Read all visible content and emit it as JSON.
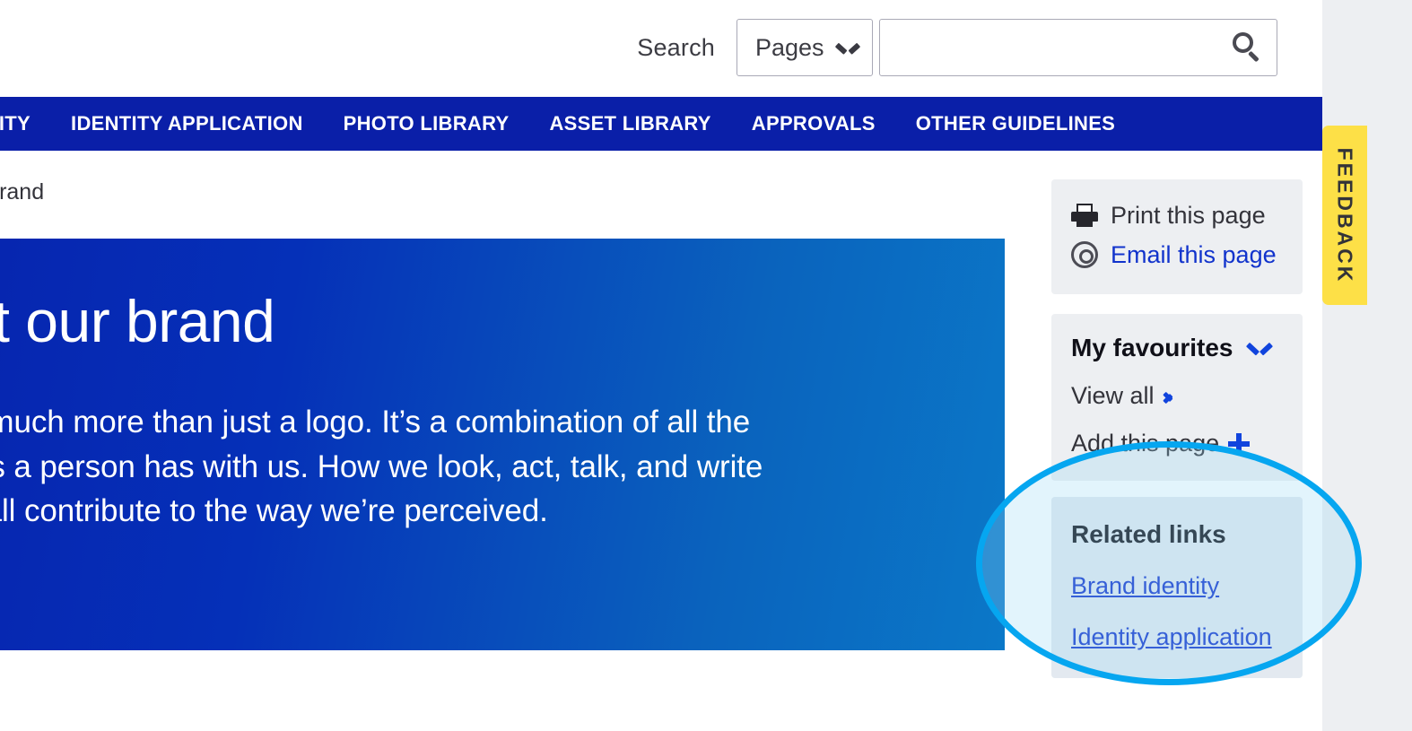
{
  "search": {
    "label": "Search",
    "scope_selected": "Pages",
    "scope_options": [
      "Pages"
    ],
    "query_value": "",
    "query_placeholder": "",
    "select_chevron_icon": "chevron-down-icon",
    "search_icon": "search-icon"
  },
  "nav": {
    "items": [
      {
        "label": "ENTITY"
      },
      {
        "label": "IDENTITY APPLICATION"
      },
      {
        "label": "PHOTO LIBRARY"
      },
      {
        "label": "ASSET LIBRARY"
      },
      {
        "label": "APPROVALS"
      },
      {
        "label": "OTHER GUIDELINES"
      }
    ]
  },
  "breadcrumb": {
    "text": "ur brand"
  },
  "hero": {
    "title": "bout our brand",
    "body_lines": [
      "and is much more than just a logo. It’s a combination of all the",
      "ractions a person has with us. How we look, act, talk, and write",
      "brand all contribute to the way we’re perceived."
    ]
  },
  "sidebar": {
    "utility": {
      "print": {
        "label": "Print this page",
        "icon": "printer-icon"
      },
      "email": {
        "label": "Email this page",
        "icon": "at-icon"
      }
    },
    "favourites": {
      "title": "My favourites",
      "chevron_icon": "chevron-down-icon",
      "view_all": {
        "label": "View all",
        "icon": "chevron-right-icon"
      },
      "add_page": {
        "label": "Add this page",
        "icon": "plus-icon"
      }
    },
    "related": {
      "title": "Related links",
      "links": [
        {
          "label": "Brand identity"
        },
        {
          "label": "Identity application"
        }
      ]
    }
  },
  "feedback": {
    "label": "FEEDBACK"
  },
  "colors": {
    "nav_blue": "#0a1fa8",
    "hero_gradient_start": "#0626b0",
    "hero_gradient_end": "#0b78c8",
    "link_blue": "#1133cc",
    "accent_blue": "#1144dd",
    "panel_grey": "#edeff2",
    "related_panel": "#e3e9f0",
    "highlight_stroke": "#06a6f0",
    "feedback_yellow": "#fde047",
    "page_background": "#edeff2"
  }
}
